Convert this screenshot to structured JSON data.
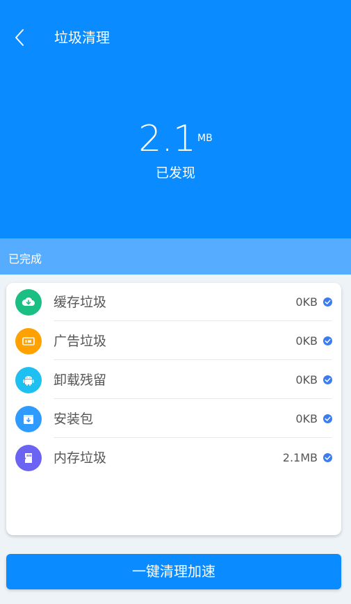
{
  "header": {
    "title": "垃圾清理"
  },
  "hero": {
    "value": "2.1",
    "unit": "MB",
    "subtitle": "已发现"
  },
  "status": {
    "label": "已完成"
  },
  "items": [
    {
      "label": "缓存垃圾",
      "size": "0KB",
      "icon": "cloud-download-icon",
      "color": "#1bbf83"
    },
    {
      "label": "广告垃圾",
      "size": "0KB",
      "icon": "ad-icon",
      "color": "#ffa100"
    },
    {
      "label": "卸载残留",
      "size": "0KB",
      "icon": "android-icon",
      "color": "#1ec0f2"
    },
    {
      "label": "安装包",
      "size": "0KB",
      "icon": "package-icon",
      "color": "#2f9bff"
    },
    {
      "label": "内存垃圾",
      "size": "2.1MB",
      "icon": "memory-icon",
      "color": "#6b63f2"
    }
  ],
  "action": {
    "label": "一键清理加速"
  },
  "colors": {
    "primary": "#0a8bff",
    "status_bar": "#56adff",
    "check": "#3b7df0"
  }
}
